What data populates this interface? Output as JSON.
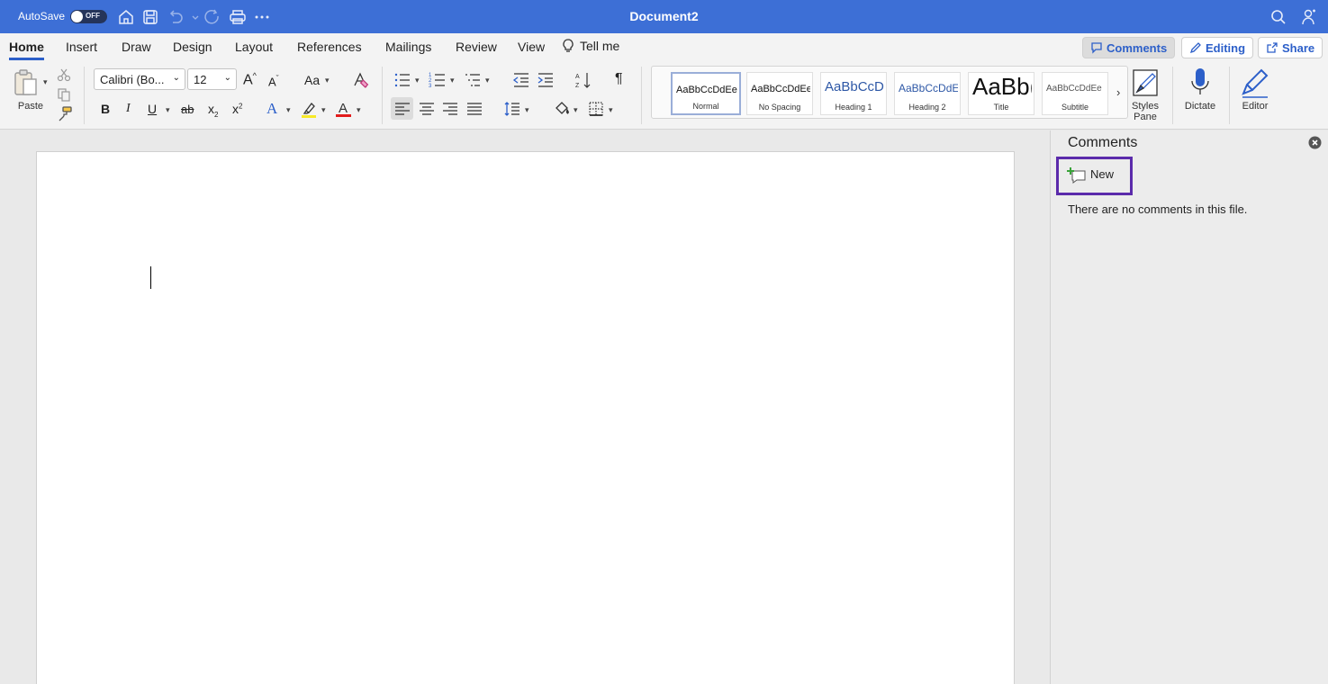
{
  "titlebar": {
    "autosave_label": "AutoSave",
    "autosave_state": "OFF",
    "document_title": "Document2"
  },
  "tabs": [
    {
      "label": "Home",
      "active": true
    },
    {
      "label": "Insert"
    },
    {
      "label": "Draw"
    },
    {
      "label": "Design"
    },
    {
      "label": "Layout"
    },
    {
      "label": "References"
    },
    {
      "label": "Mailings"
    },
    {
      "label": "Review"
    },
    {
      "label": "View"
    }
  ],
  "tell_me": "Tell me",
  "ribbon_buttons": {
    "comments": "Comments",
    "editing": "Editing",
    "share": "Share"
  },
  "ribbon": {
    "paste_label": "Paste",
    "font_name": "Calibri (Bo...",
    "font_size": "12",
    "change_case": "Aa",
    "bold": "B",
    "italic": "I",
    "underline": "U",
    "strikethrough": "ab",
    "subscript": "x",
    "superscript": "x",
    "styles": [
      {
        "sample": "AaBbCcDdEe",
        "name": "Normal"
      },
      {
        "sample": "AaBbCcDdEe",
        "name": "No Spacing"
      },
      {
        "sample": "AaBbCcDc",
        "name": "Heading 1"
      },
      {
        "sample": "AaBbCcDdEe",
        "name": "Heading 2"
      },
      {
        "sample": "AaBb(",
        "name": "Title"
      },
      {
        "sample": "AaBbCcDdEe",
        "name": "Subtitle"
      }
    ],
    "styles_pane_line1": "Styles",
    "styles_pane_line2": "Pane",
    "dictate": "Dictate",
    "editor": "Editor"
  },
  "comments_pane": {
    "title": "Comments",
    "new_label": "New",
    "empty_message": "There are no comments in this file."
  },
  "colors": {
    "titlebar": "#3d6fd6",
    "accent": "#2c5fc9",
    "highlight_outline": "#5b2bab"
  }
}
